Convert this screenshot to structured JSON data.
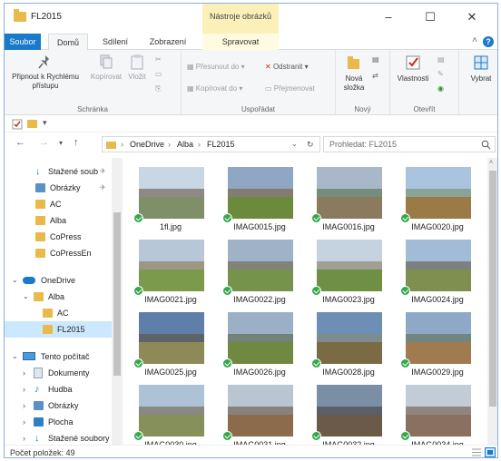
{
  "window": {
    "title": "FL2015",
    "tools_tab": "Nástroje obrázků",
    "minimize": "–",
    "maximize": "☐",
    "close": "✕"
  },
  "tabs": {
    "file": "Soubor",
    "home": "Domů",
    "share": "Sdílení",
    "view": "Zobrazení",
    "manage": "Spravovat"
  },
  "ribbon": {
    "pin": "Připnout k Rychlému přístupu",
    "copy": "Kopírovat",
    "paste": "Vložit",
    "group_clipboard": "Schránka",
    "move_to": "Přesunout do",
    "copy_to": "Kopírovat do",
    "delete": "Odstranit",
    "rename": "Přejmenovat",
    "group_organize": "Uspořádat",
    "new_folder": "Nová složka",
    "group_new": "Nový",
    "properties": "Vlastnosti",
    "group_open": "Otevřít",
    "select": "Vybrat"
  },
  "address": {
    "crumbs": [
      "OneDrive",
      "Alba",
      "FL2015"
    ],
    "search_placeholder": "Prohledat: FL2015"
  },
  "nav": {
    "items": [
      {
        "label": "Stažené soub",
        "icon": "download-icon",
        "pinned": true
      },
      {
        "label": "Obrázky",
        "icon": "pictures-icon",
        "pinned": true
      },
      {
        "label": "AC",
        "icon": "folder-icon"
      },
      {
        "label": "Alba",
        "icon": "folder-icon"
      },
      {
        "label": "CoPress",
        "icon": "folder-icon"
      },
      {
        "label": "CoPressEn",
        "icon": "folder-icon"
      },
      {
        "label": "OneDrive",
        "icon": "onedrive-icon"
      },
      {
        "label": "Alba",
        "icon": "folder-icon"
      },
      {
        "label": "AC",
        "icon": "folder-icon"
      },
      {
        "label": "FL2015",
        "icon": "folder-icon"
      },
      {
        "label": "Tento počítač",
        "icon": "computer-icon"
      },
      {
        "label": "Dokumenty",
        "icon": "documents-icon"
      },
      {
        "label": "Hudba",
        "icon": "music-icon"
      },
      {
        "label": "Obrázky",
        "icon": "pictures-icon"
      },
      {
        "label": "Plocha",
        "icon": "desktop-icon"
      },
      {
        "label": "Stažené soubory",
        "icon": "download-icon"
      }
    ]
  },
  "files": [
    "1fl.jpg",
    "IMAG0015.jpg",
    "IMAG0016.jpg",
    "IMAG0020.jpg",
    "IMAG0021.jpg",
    "IMAG0022.jpg",
    "IMAG0023.jpg",
    "IMAG0024.jpg",
    "IMAG0025.jpg",
    "IMAG0026.jpg",
    "IMAG0028.jpg",
    "IMAG0029.jpg",
    "IMAG0030.jpg",
    "IMAG0031.jpg",
    "IMAG0032.jpg",
    "IMAG0034.jpg"
  ],
  "status": {
    "count": "Počet položek: 49"
  },
  "colors": {
    "accent": "#1979ca",
    "folder": "#e9b94a",
    "selected": "#cce8ff",
    "sync_check": "#34a84b"
  }
}
